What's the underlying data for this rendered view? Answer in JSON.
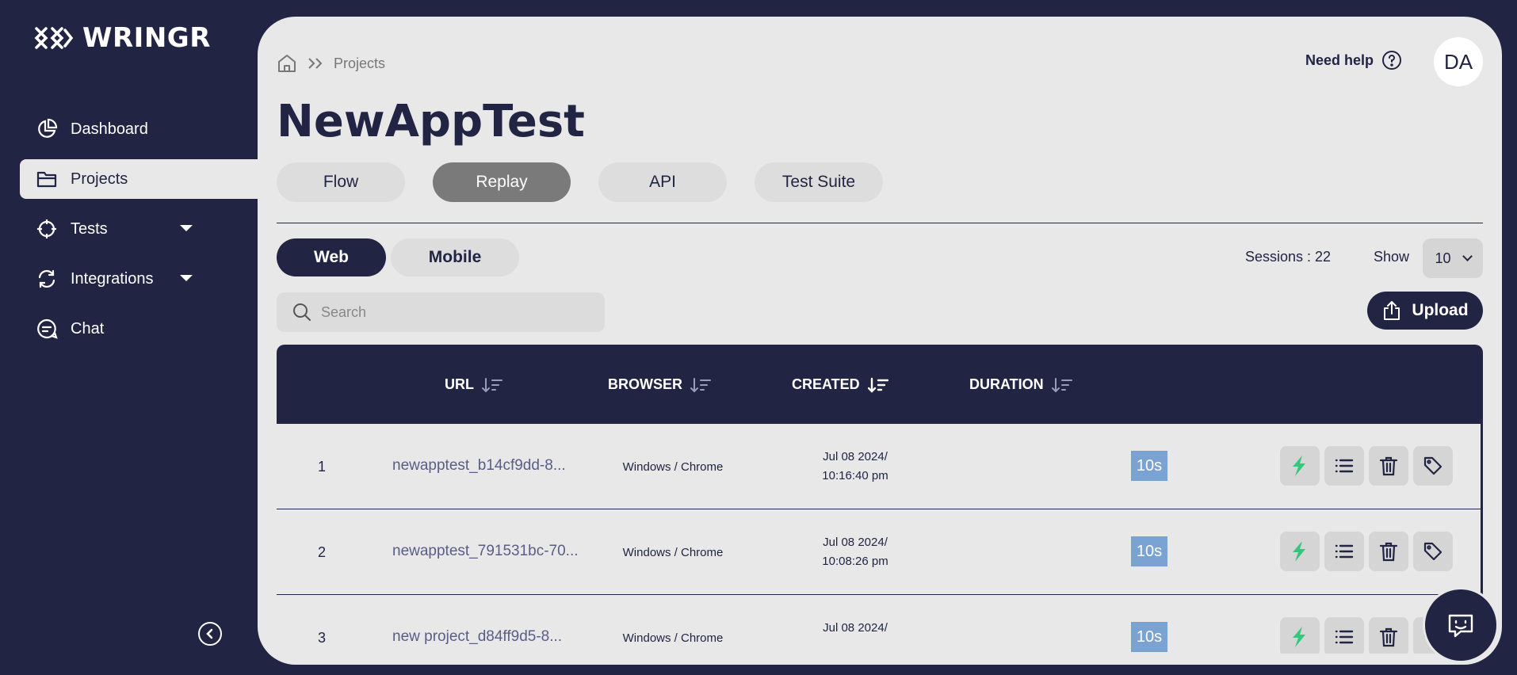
{
  "brand": {
    "name": "WRINGR"
  },
  "sidebar": {
    "items": [
      {
        "label": "Dashboard",
        "icon": "pie-chart-icon"
      },
      {
        "label": "Projects",
        "icon": "folder-icon",
        "active": true
      },
      {
        "label": "Tests",
        "icon": "crosshair-icon",
        "expandable": true
      },
      {
        "label": "Integrations",
        "icon": "refresh-icon",
        "expandable": true
      },
      {
        "label": "Chat",
        "icon": "chat-bubble-icon"
      }
    ],
    "collapse_icon": "chevron-left-icon"
  },
  "header": {
    "breadcrumb": {
      "current": "Projects"
    },
    "help_label": "Need help",
    "avatar_initials": "DA"
  },
  "page_title": "NewAppTest",
  "tabs": [
    {
      "label": "Flow"
    },
    {
      "label": "Replay",
      "active": true
    },
    {
      "label": "API"
    },
    {
      "label": "Test Suite"
    }
  ],
  "subtabs": [
    {
      "label": "Web",
      "active": true
    },
    {
      "label": "Mobile"
    }
  ],
  "sessions_label": "Sessions : 22",
  "show": {
    "label": "Show",
    "value": "10"
  },
  "search": {
    "placeholder": "Search"
  },
  "upload_label": "Upload",
  "table": {
    "columns": [
      "URL",
      "BROWSER",
      "CREATED",
      "DURATION"
    ],
    "rows": [
      {
        "num": "1",
        "url": "newapptest_b14cf9dd-8...",
        "browser": "Windows / Chrome",
        "created_date": "Jul 08 2024/",
        "created_time": "10:16:40 pm",
        "duration": "10s"
      },
      {
        "num": "2",
        "url": "newapptest_791531bc-70...",
        "browser": "Windows / Chrome",
        "created_date": "Jul 08 2024/",
        "created_time": "10:08:26 pm",
        "duration": "10s"
      },
      {
        "num": "3",
        "url": "new project_d84ff9d5-8...",
        "browser": "Windows / Chrome",
        "created_date": "Jul 08 2024/",
        "created_time": "",
        "duration": "10s"
      }
    ]
  },
  "colors": {
    "navy": "#222444",
    "panel": "#e8e8e8",
    "accent_green": "#34c77b",
    "duration_badge": "#7aa3d4"
  }
}
